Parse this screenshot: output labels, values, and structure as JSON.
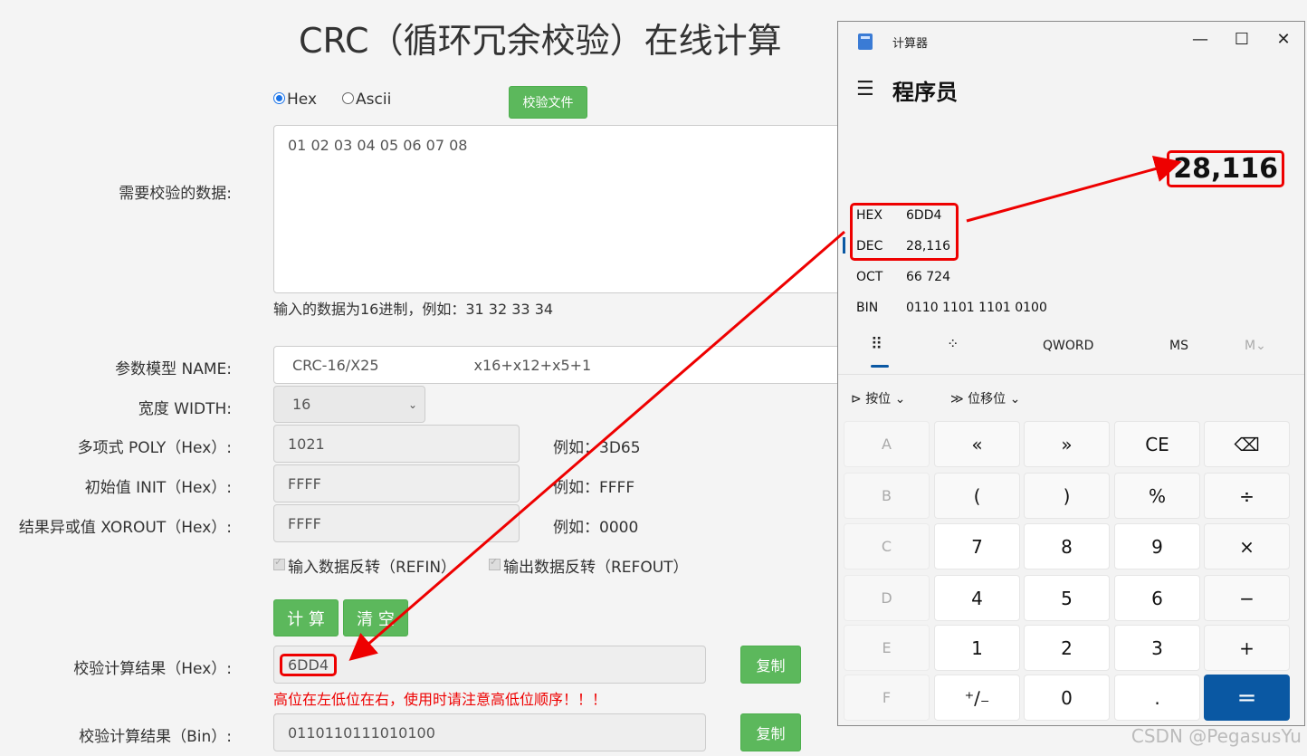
{
  "page": {
    "title": "CRC（循环冗余校验）在线计算",
    "radio_hex": "Hex",
    "radio_ascii": "Ascii",
    "check_file_button": "校验文件",
    "data_label": "需要校验的数据:",
    "data_value": "01 02 03 04 05 06 07 08",
    "data_hint": "输入的数据为16进制，例如：31 32 33 34",
    "model_label": "参数模型 NAME:",
    "model_value": "CRC-16/X25",
    "model_poly_text": "x16+x12+x5+1",
    "width_label": "宽度 WIDTH:",
    "width_value": "16",
    "poly_label": "多项式 POLY（Hex）:",
    "poly_value": "1021",
    "poly_example": "例如：3D65",
    "init_label": "初始值 INIT（Hex）:",
    "init_value": "FFFF",
    "init_example": "例如：FFFF",
    "xorout_label": "结果异或值 XOROUT（Hex）:",
    "xorout_value": "FFFF",
    "xorout_example": "例如：0000",
    "refin_label": "输入数据反转（REFIN）",
    "refout_label": "输出数据反转（REFOUT）",
    "calc_button": "计 算",
    "clear_button": "清 空",
    "result_hex_label": "校验计算结果（Hex）:",
    "result_hex_value": "6DD4",
    "copy_button": "复制",
    "warning": "高位在左低位在右，使用时请注意高低位顺序！！！",
    "result_bin_label": "校验计算结果（Bin）:",
    "result_bin_value": "0110110111010100",
    "copy_button2": "复制"
  },
  "calculator": {
    "window_title": "计算器",
    "minimize": "—",
    "maximize": "☐",
    "close": "✕",
    "mode": "程序员",
    "display": "28,116",
    "radix": [
      {
        "key": "HEX",
        "value": "6DD4"
      },
      {
        "key": "DEC",
        "value": "28,116"
      },
      {
        "key": "OCT",
        "value": "66 724"
      },
      {
        "key": "BIN",
        "value": "0110 1101 1101 0100"
      }
    ],
    "tab_keypad": "⠿",
    "tab_bits": "⁘",
    "word_size": "QWORD",
    "ms": "MS",
    "mv": "M⌄",
    "bitwise": "按位",
    "bitshift": "位移位",
    "keys": [
      [
        "A",
        "«",
        "»",
        "CE",
        "⌫"
      ],
      [
        "B",
        "(",
        ")",
        "%",
        "÷"
      ],
      [
        "C",
        "7",
        "8",
        "9",
        "×"
      ],
      [
        "D",
        "4",
        "5",
        "6",
        "−"
      ],
      [
        "E",
        "1",
        "2",
        "3",
        "+"
      ],
      [
        "F",
        "⁺∕₋",
        "0",
        ".",
        "="
      ]
    ]
  },
  "watermark": "CSDN @PegasusYu",
  "colors": {
    "accent_green": "#5cb85c",
    "highlight_red": "#e00000",
    "calc_equals": "#0a58a3"
  }
}
